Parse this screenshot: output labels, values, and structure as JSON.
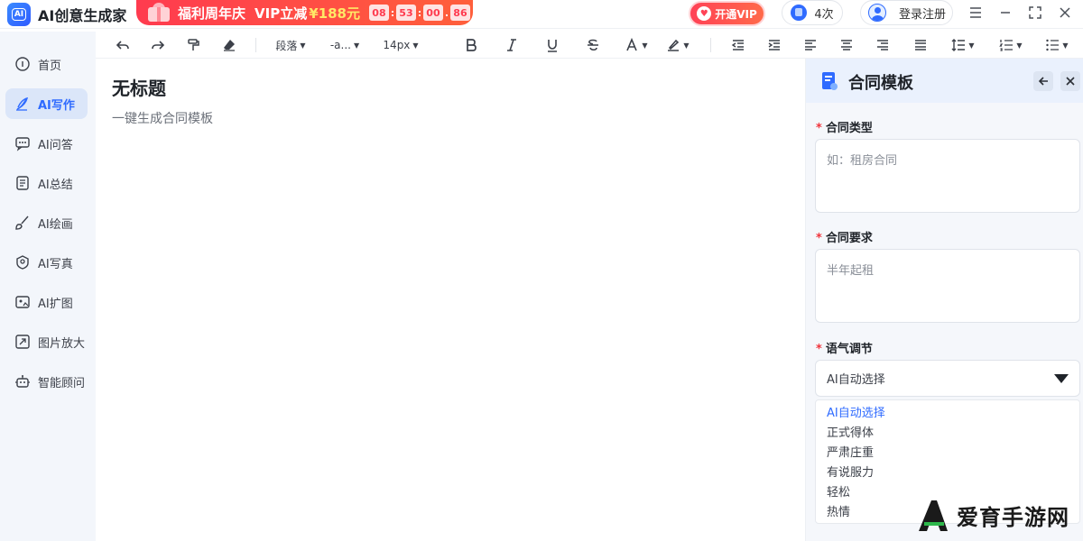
{
  "app": {
    "title": "AI创意生成家",
    "logo_text": "AI"
  },
  "promo": {
    "text": "福利周年庆",
    "vip_text": "VIP立减",
    "price": "¥188元",
    "countdown": [
      "08",
      "53",
      "00",
      "86"
    ],
    "separators": [
      ":",
      ":",
      "."
    ]
  },
  "header": {
    "vip_button": "开通VIP",
    "quota": "4次",
    "login": "登录注册"
  },
  "sidebar": {
    "items": [
      {
        "label": "首页",
        "icon": "home-icon"
      },
      {
        "label": "AI写作",
        "icon": "pen-icon",
        "active": true
      },
      {
        "label": "AI问答",
        "icon": "chat-icon"
      },
      {
        "label": "AI总结",
        "icon": "document-icon"
      },
      {
        "label": "AI绘画",
        "icon": "brush-icon"
      },
      {
        "label": "AI写真",
        "icon": "portrait-icon"
      },
      {
        "label": "AI扩图",
        "icon": "expand-image-icon"
      },
      {
        "label": "图片放大",
        "icon": "enlarge-icon"
      },
      {
        "label": "智能顾问",
        "icon": "robot-icon"
      }
    ]
  },
  "toolbar": {
    "paragraph": "段落",
    "font": "-a...",
    "font_size": "14px"
  },
  "document": {
    "title": "无标题",
    "subtitle": "一键生成合同模板"
  },
  "panel": {
    "title": "合同模板",
    "fields": [
      {
        "label": "合同类型",
        "placeholder": "如：租房合同"
      },
      {
        "label": "合同要求",
        "value": "半年起租"
      }
    ],
    "tone": {
      "label": "语气调节",
      "selected": "AI自动选择",
      "options": [
        "AI自动选择",
        "正式得体",
        "严肃庄重",
        "有说服力",
        "轻松",
        "热情"
      ]
    }
  },
  "watermark": {
    "text": "爱育手游网"
  },
  "colors": {
    "accent": "#2f6bff",
    "promo": "#ff3b4f",
    "required": "#f0343c"
  }
}
